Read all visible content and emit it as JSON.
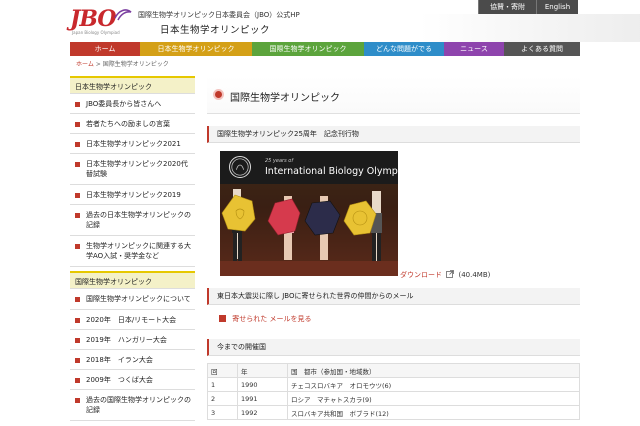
{
  "header": {
    "logo_text": "JBO",
    "logo_sub": "Japan Biology Olympiad",
    "subtitle": "国際生物学オリンピック日本委員会（JBO）公式HP",
    "title": "日本生物学オリンピック",
    "buttons": [
      "協賛・寄附",
      "English"
    ]
  },
  "nav": {
    "items": [
      {
        "label": "ホーム",
        "color": "#c0392b"
      },
      {
        "label": "日本生物学オリンピック",
        "color": "#d4a017"
      },
      {
        "label": "国際生物学オリンピック",
        "color": "#5ca43c"
      },
      {
        "label": "どんな問題がでる",
        "color": "#2e8dc9"
      },
      {
        "label": "ニュース",
        "color": "#8e44ad"
      },
      {
        "label": "よくある質問",
        "color": "#555555"
      }
    ]
  },
  "breadcrumb": {
    "home": "ホーム",
    "sep": ">",
    "current": "国際生物学オリンピック"
  },
  "sidebar": {
    "section1": "日本生物学オリンピック",
    "items1": [
      "JBO委員長から皆さんへ",
      "若者たちへの励ましの言葉",
      "日本生物学オリンピック2021",
      "日本生物学オリンピック2020代替試験",
      "日本生物学オリンピック2019",
      "過去の日本生物学オリンピックの記録",
      "生物学オリンピックに関連する大学AO入試・奨学金など"
    ],
    "section2": "国際生物学オリンピック",
    "items2": [
      "国際生物学オリンピックについて",
      "2020年　日本/リモート大会",
      "2019年　ハンガリー大会",
      "2018年　イラン大会",
      "2009年　つくば大会",
      "過去の国際生物学オリンピックの記録"
    ]
  },
  "main": {
    "page_title": "国際生物学オリンピック",
    "section_a": "国際生物学オリンピック25周年　記念刊行物",
    "photo_line1": "25 years of",
    "photo_line2": "International Biology Olympiad",
    "download_label": "ダウンロード",
    "download_size": "(40.4MB)",
    "section_b": "東日本大震災に際し JBOに寄せられた世界の仲間からのメール",
    "mail_link": "寄せられた メールを見る",
    "section_c": "今までの開催国",
    "table": {
      "headers": [
        "回",
        "年",
        "国　都市（参加国・地域数）"
      ],
      "rows": [
        [
          "1",
          "1990",
          "チェコスロバキア　オロモウツ(6)"
        ],
        [
          "2",
          "1991",
          "ロシア　マチャトスカラ(9)"
        ],
        [
          "3",
          "1992",
          "スロバキア共和国　ボブラド(12)"
        ]
      ]
    }
  }
}
